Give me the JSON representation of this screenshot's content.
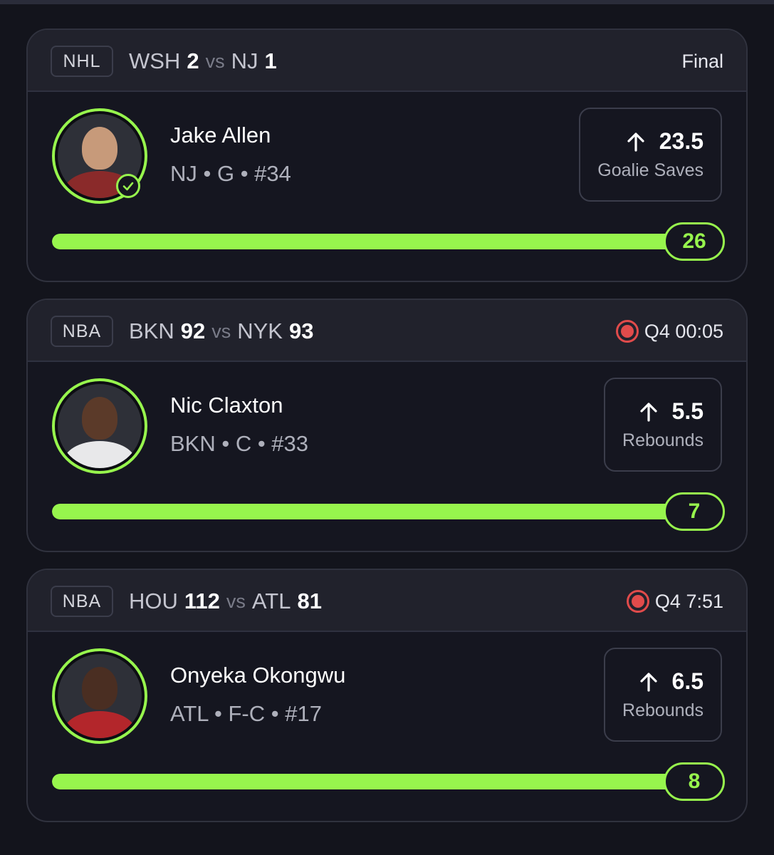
{
  "colors": {
    "accent": "#97f54d",
    "live": "#e14b4b",
    "background": "#13141c",
    "card": "#151620"
  },
  "cards": [
    {
      "league": "NHL",
      "team1": "WSH",
      "score1": "2",
      "vs": "vs",
      "team2": "NJ",
      "score2": "1",
      "status": "Final",
      "live": false,
      "player_name": "Jake Allen",
      "player_meta": "NJ • G • #34",
      "verified": true,
      "line": "23.5",
      "direction_icon": "arrow-up-icon",
      "stat": "Goalie Saves",
      "current": "26",
      "progress": 1.0,
      "avatar_colors": {
        "head": "#c79a7a",
        "body": "#8a2a2a"
      }
    },
    {
      "league": "NBA",
      "team1": "BKN",
      "score1": "92",
      "vs": "vs",
      "team2": "NYK",
      "score2": "93",
      "status": "Q4 00:05",
      "live": true,
      "player_name": "Nic Claxton",
      "player_meta": "BKN • C • #33",
      "verified": false,
      "line": "5.5",
      "direction_icon": "arrow-up-icon",
      "stat": "Rebounds",
      "current": "7",
      "progress": 1.0,
      "avatar_colors": {
        "head": "#5b3a29",
        "body": "#e8e8ea"
      }
    },
    {
      "league": "NBA",
      "team1": "HOU",
      "score1": "112",
      "vs": "vs",
      "team2": "ATL",
      "score2": "81",
      "status": "Q4 7:51",
      "live": true,
      "player_name": "Onyeka Okongwu",
      "player_meta": "ATL • F-C • #17",
      "verified": false,
      "line": "6.5",
      "direction_icon": "arrow-up-icon",
      "stat": "Rebounds",
      "current": "8",
      "progress": 1.0,
      "avatar_colors": {
        "head": "#4a2e22",
        "body": "#b3262b"
      }
    }
  ]
}
